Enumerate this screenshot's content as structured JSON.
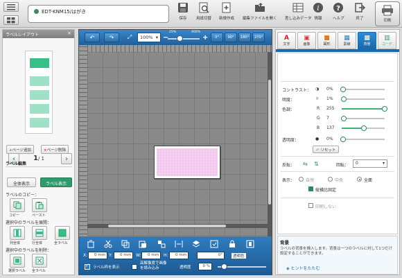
{
  "topbar": {
    "filename": "EDT-KNM15/はがき",
    "tools": [
      {
        "icon": "save-icon",
        "label": "保存"
      },
      {
        "icon": "paper-switch-icon",
        "label": "用紙切替"
      },
      {
        "icon": "new-icon",
        "label": "新規作成"
      },
      {
        "icon": "open-file-icon",
        "label": "編集ファイルを開く"
      },
      {
        "icon": "diff-data-icon",
        "label": "差し込みデータ"
      },
      {
        "icon": "info-icon",
        "label": "情報"
      },
      {
        "icon": "help-icon",
        "label": "ヘルプ"
      },
      {
        "icon": "exit-icon",
        "label": "終了"
      }
    ],
    "print_label": "印刷"
  },
  "left_panel": {
    "title": "ラベルレイアウト",
    "close": "×",
    "page_current": "1",
    "page_total": "/ 1",
    "add_page": "ページ追加",
    "delete_page": "ページ削除",
    "edit_section": "ラベル編集",
    "view_all": "全体表示",
    "view_label": "ラベル表示",
    "copy_section": "ラベルのコピー：",
    "copy_btn": "コピー",
    "paste_btn": "ペースト",
    "expand_section": "選択中のラベルを展開：",
    "expand_col": "列全体",
    "expand_row": "行全体",
    "expand_all": "全ラベル",
    "delete_section": "選択中のラベルを削除：",
    "delete_selected": "選択ラベル",
    "delete_all": "全ラベル"
  },
  "canvas": {
    "zoom": "100%",
    "zoom_min": "25%",
    "zoom_max": "400%",
    "x_label": "X:",
    "x_value": "0 mm",
    "y_label": "Y:",
    "y_value": "0 mm",
    "w_label": "W:",
    "w_value": "0 mm",
    "h_label": "H:",
    "h_value": "0 mm",
    "rotation": "0°",
    "transparent_label": "透明色",
    "show_frame": "ラベル枠を表示",
    "high_res": "高解像度で画像を読み込み",
    "opacity_label": "透明度",
    "opacity_value": "0 %"
  },
  "right_panel": {
    "tabs": [
      "文字",
      "画像",
      "図形",
      "罫線",
      "背景",
      "コード"
    ],
    "active_tab": 4,
    "contrast_label": "コントラスト：",
    "contrast_value": "0%",
    "brightness_label": "明度：",
    "brightness_value": "1%",
    "hue_label": "色調：",
    "r_label": "R",
    "r_value": "255",
    "g_label": "G",
    "g_value": "7",
    "b_label": "B",
    "b_value": "137",
    "transparency_label": "透明度：",
    "transparency_value": "0%",
    "reset": "リセット",
    "flip_label": "反転：",
    "rotate_label": "回転：",
    "rotate_value": "0",
    "display_label": "表示：",
    "opt_original": "自然",
    "opt_center": "中央",
    "opt_full": "全面",
    "keep_ratio": "縦横比固定",
    "no_print": "印刷しない",
    "hint_title": "背景",
    "hint_desc": "ラベルの背景を挿入します。背景は一つのラベルに対して1つだけ設定することができます。",
    "hint_toggle": "ヒントをたたむ"
  }
}
